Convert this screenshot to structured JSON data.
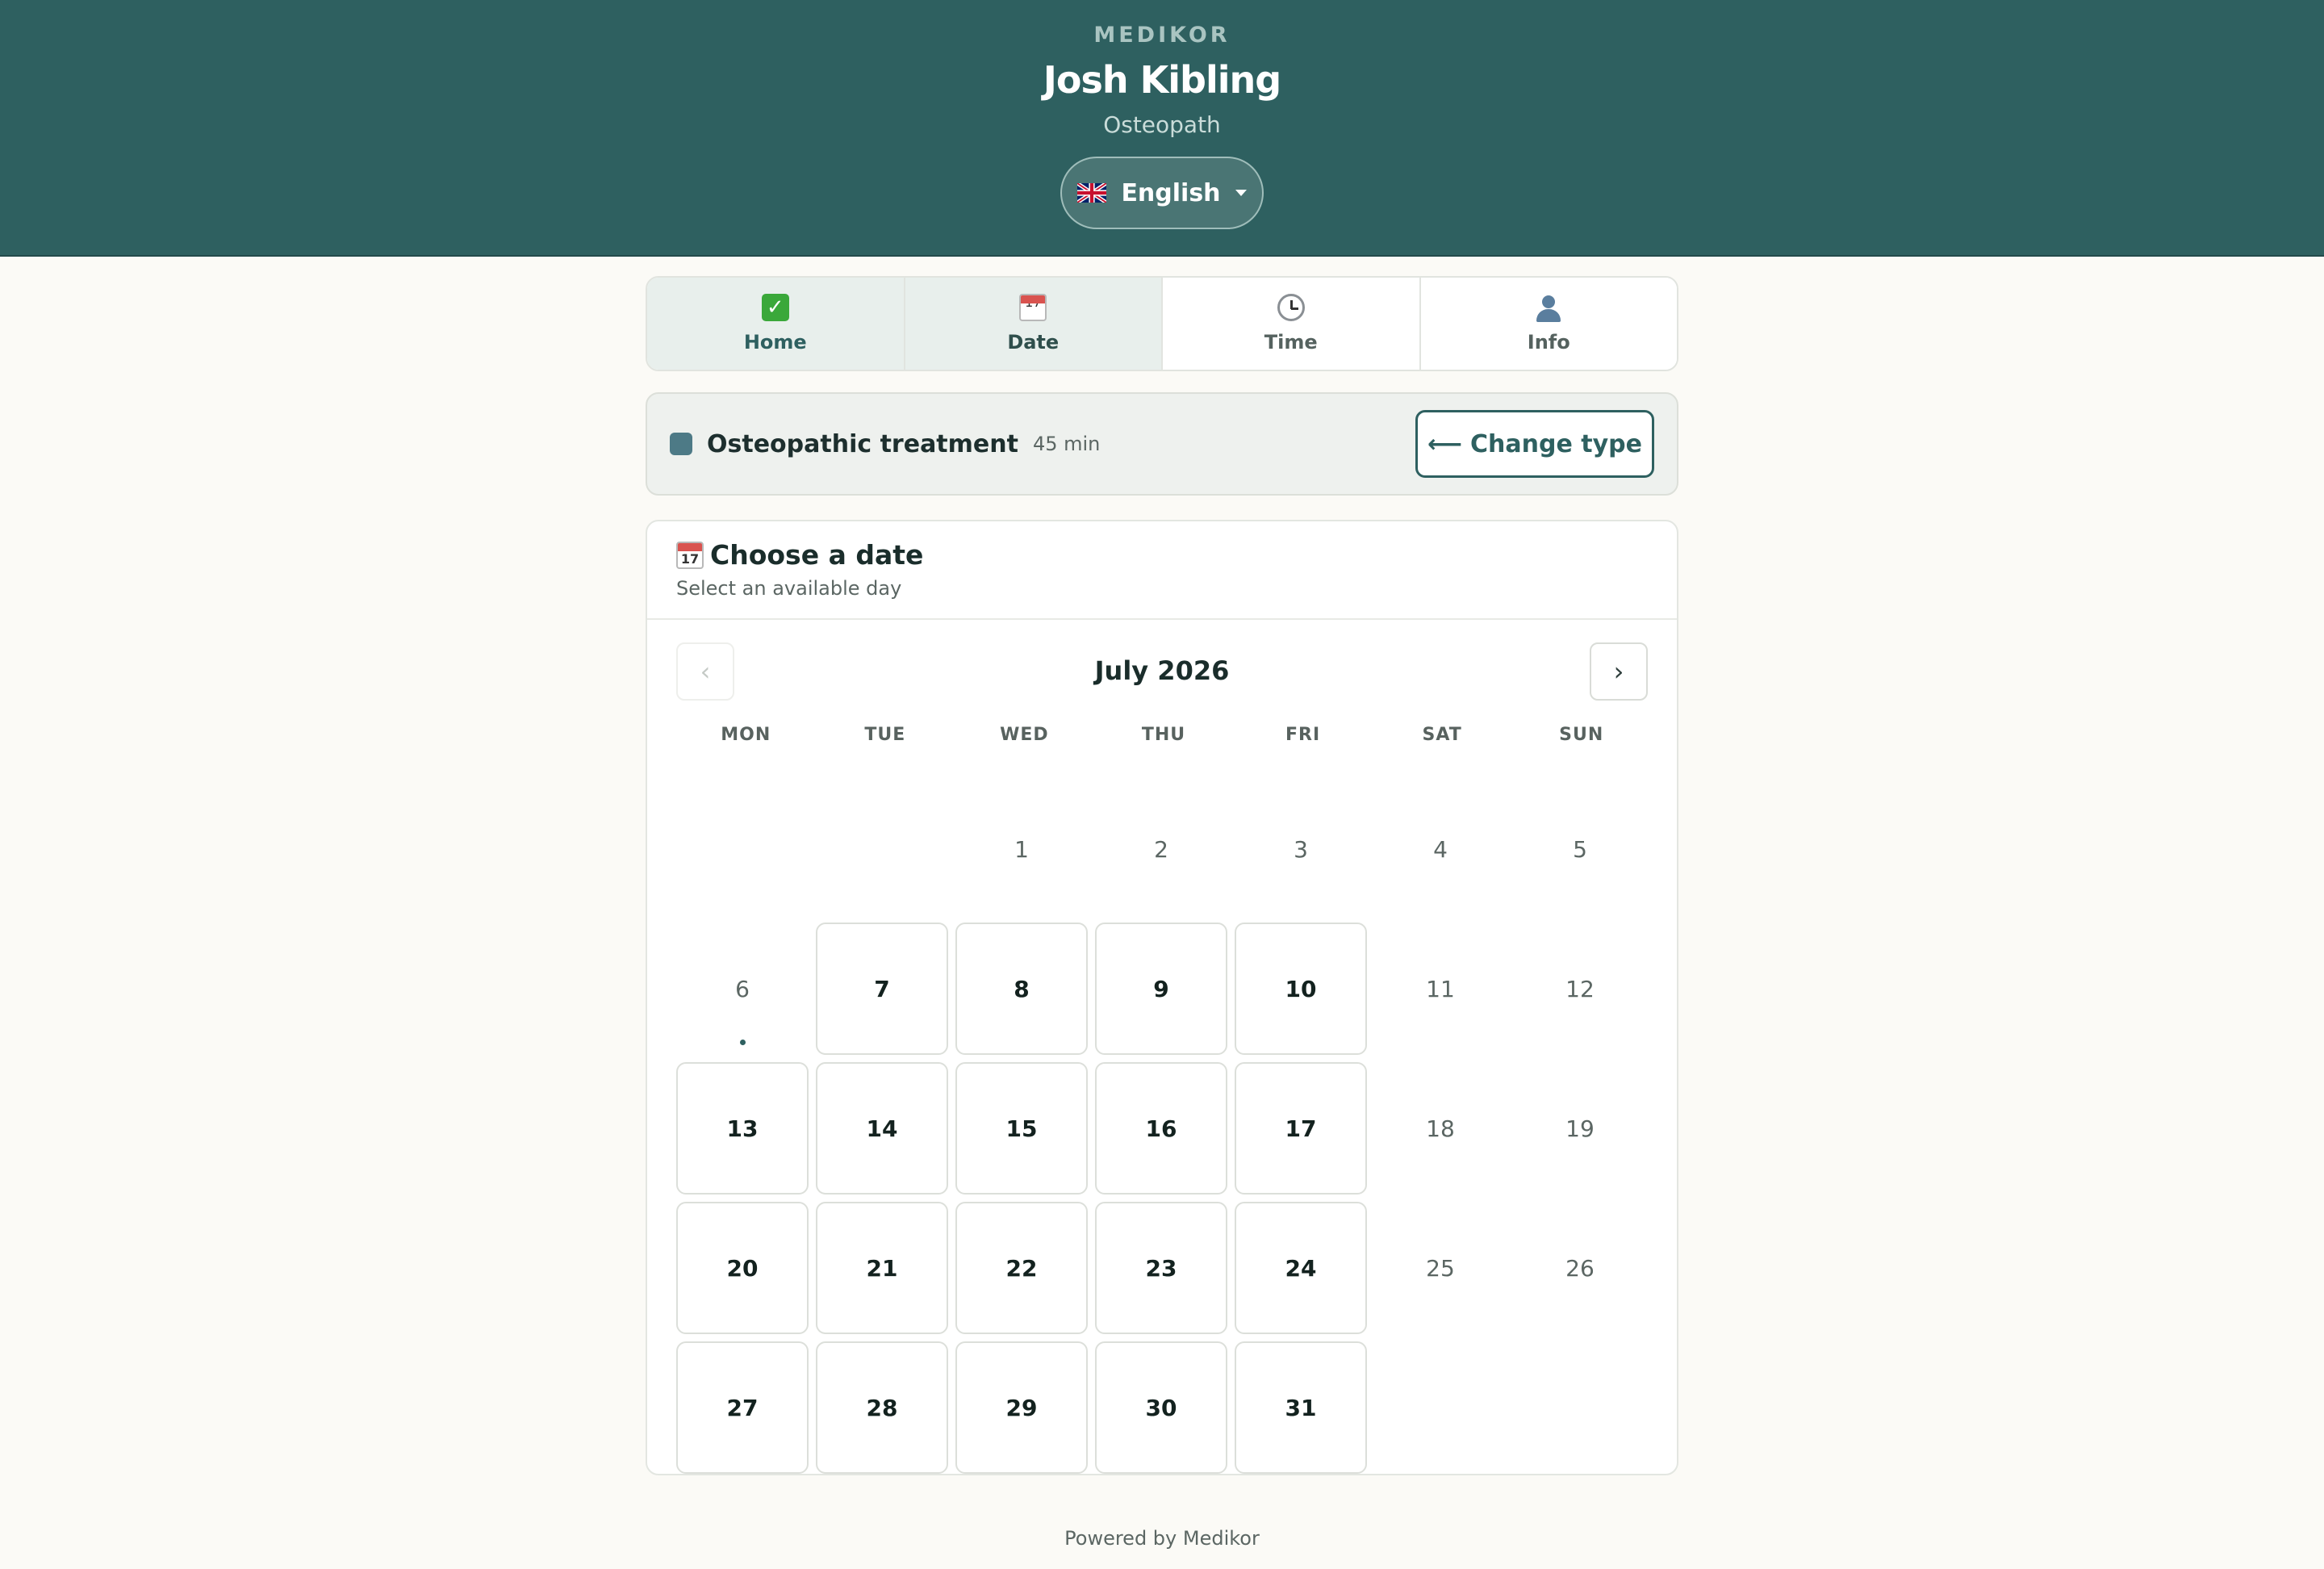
{
  "header": {
    "brand": "MEDIKOR",
    "practitioner_name": "Josh Kibling",
    "practitioner_role": "Osteopath",
    "language": "English"
  },
  "steps": [
    {
      "label": "Home",
      "icon": "check-icon",
      "state": "done"
    },
    {
      "label": "Date",
      "icon": "calendar-icon",
      "state": "current"
    },
    {
      "label": "Time",
      "icon": "clock-icon",
      "state": "upcoming"
    },
    {
      "label": "Info",
      "icon": "person-icon",
      "state": "upcoming"
    }
  ],
  "appointment": {
    "name": "Osteopathic treatment",
    "duration": "45 min",
    "color": "#4d7a86",
    "change_label": "Change type"
  },
  "calendar": {
    "title": "Choose a date",
    "subtitle": "Select an available day",
    "month": "July 2026",
    "prev_label": "‹",
    "next_label": "›",
    "weekdays": [
      "MON",
      "TUE",
      "WED",
      "THU",
      "FRI",
      "SAT",
      "SUN"
    ],
    "leading_blanks": 2,
    "days": [
      {
        "d": "1",
        "available": false
      },
      {
        "d": "2",
        "available": false
      },
      {
        "d": "3",
        "available": false
      },
      {
        "d": "4",
        "available": false
      },
      {
        "d": "5",
        "available": false
      },
      {
        "d": "6",
        "available": false,
        "today": true
      },
      {
        "d": "7",
        "available": true
      },
      {
        "d": "8",
        "available": true
      },
      {
        "d": "9",
        "available": true
      },
      {
        "d": "10",
        "available": true
      },
      {
        "d": "11",
        "available": false
      },
      {
        "d": "12",
        "available": false
      },
      {
        "d": "13",
        "available": true
      },
      {
        "d": "14",
        "available": true
      },
      {
        "d": "15",
        "available": true
      },
      {
        "d": "16",
        "available": true
      },
      {
        "d": "17",
        "available": true
      },
      {
        "d": "18",
        "available": false
      },
      {
        "d": "19",
        "available": false
      },
      {
        "d": "20",
        "available": true
      },
      {
        "d": "21",
        "available": true
      },
      {
        "d": "22",
        "available": true
      },
      {
        "d": "23",
        "available": true
      },
      {
        "d": "24",
        "available": true
      },
      {
        "d": "25",
        "available": false
      },
      {
        "d": "26",
        "available": false
      },
      {
        "d": "27",
        "available": true
      },
      {
        "d": "28",
        "available": true
      },
      {
        "d": "29",
        "available": true
      },
      {
        "d": "30",
        "available": true
      },
      {
        "d": "31",
        "available": true
      }
    ]
  },
  "footer": {
    "text": "Powered by Medikor"
  },
  "colors": {
    "header_bg": "#2e6060",
    "accent": "#2e6060",
    "page_bg": "#fbfaf6"
  }
}
